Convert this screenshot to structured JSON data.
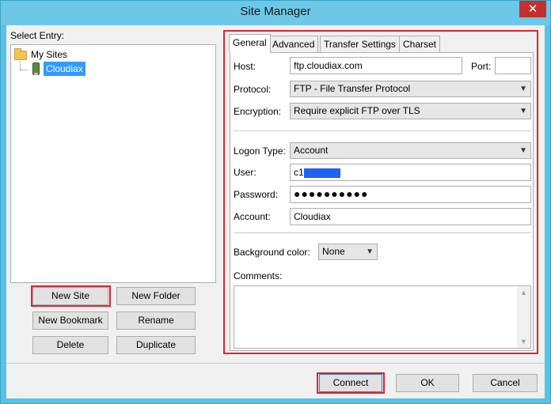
{
  "window": {
    "title": "Site Manager",
    "close_glyph": "✕"
  },
  "left": {
    "select_entry_label": "Select Entry:",
    "tree": {
      "root_label": "My Sites",
      "child_label": "Cloudiax"
    },
    "buttons": {
      "new_site": "New Site",
      "new_folder": "New Folder",
      "new_bookmark": "New Bookmark",
      "rename": "Rename",
      "delete": "Delete",
      "duplicate": "Duplicate"
    }
  },
  "tabs": [
    {
      "label": "General",
      "active": true
    },
    {
      "label": "Advanced",
      "active": false
    },
    {
      "label": "Transfer Settings",
      "active": false
    },
    {
      "label": "Charset",
      "active": false
    }
  ],
  "general": {
    "host_label": "Host:",
    "host_value": "ftp.cloudiax.com",
    "port_label": "Port:",
    "port_value": "",
    "protocol_label": "Protocol:",
    "protocol_value": "FTP - File Transfer Protocol",
    "encryption_label": "Encryption:",
    "encryption_value": "Require explicit FTP over TLS",
    "logon_type_label": "Logon Type:",
    "logon_type_value": "Account",
    "user_label": "User:",
    "user_value": "c1",
    "password_label": "Password:",
    "password_value": "●●●●●●●●●●",
    "account_label": "Account:",
    "account_value": "Cloudiax",
    "bg_color_label": "Background color:",
    "bg_color_value": "None",
    "comments_label": "Comments:"
  },
  "footer": {
    "connect": "Connect",
    "ok": "OK",
    "cancel": "Cancel"
  },
  "colors": {
    "highlight": "#e0222e",
    "selection": "#3399ff",
    "titlebar": "#6cc8e6"
  },
  "icons": {
    "close": "close-icon",
    "folder": "folder-icon",
    "server": "server-icon",
    "dropdown": "chevron-down-icon"
  }
}
